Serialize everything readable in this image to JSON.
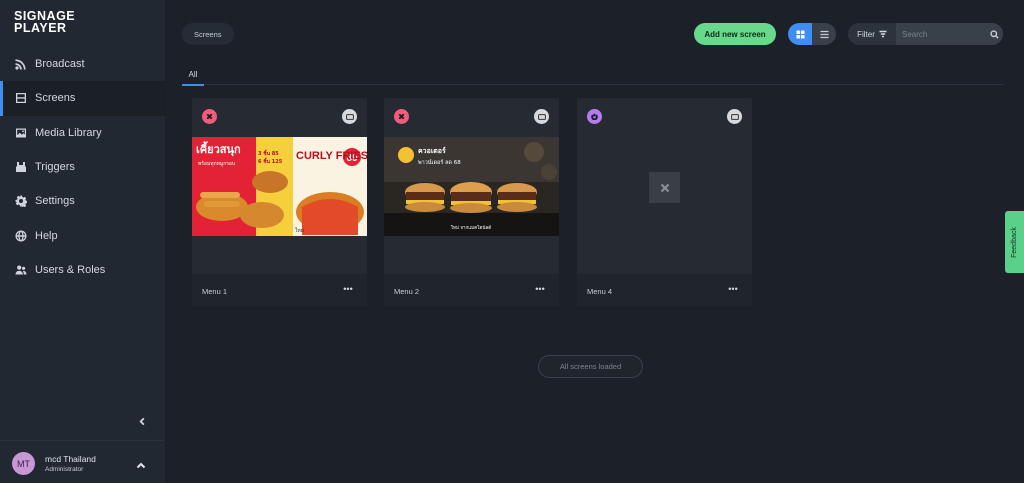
{
  "logo": {
    "line1": "SIGNAGE",
    "line2": "PLAYER"
  },
  "nav": {
    "items": [
      {
        "label": "Broadcast",
        "icon": "rss-icon"
      },
      {
        "label": "Screens",
        "icon": "screens-icon",
        "active": true
      },
      {
        "label": "Media Library",
        "icon": "image-icon"
      },
      {
        "label": "Triggers",
        "icon": "trigger-icon"
      },
      {
        "label": "Settings",
        "icon": "gear-icon"
      },
      {
        "label": "Help",
        "icon": "globe-icon"
      },
      {
        "label": "Users & Roles",
        "icon": "users-icon"
      }
    ]
  },
  "user": {
    "initials": "MT",
    "name": "mcd Thailand",
    "role": "Administrator"
  },
  "header": {
    "breadcrumb": "Screens",
    "add_button": "Add new screen",
    "filter_label": "Filter",
    "search_placeholder": "Search"
  },
  "tabs": [
    {
      "label": "All",
      "active": true
    }
  ],
  "screens": [
    {
      "name": "Menu 1",
      "status": "offline",
      "status_color": "#f25c7a",
      "preview": {
        "headline": "เคี้ยวสนุก",
        "sub": "พร้อมทุกหมูกรอบ",
        "product": "CURLY FRIES",
        "price": "89",
        "price_a": "3 ชิ้น 85",
        "price_b": "6 ชิ้น 125",
        "label_new": "ใหม่"
      }
    },
    {
      "name": "Menu 2",
      "status": "offline",
      "status_color": "#f25c7a",
      "preview": {
        "headline": "ควอเตอร์",
        "sub": "พาวน์เดอร์ ลด 68",
        "caption": "ใหม่ จากแมคโดนัลด์"
      }
    },
    {
      "name": "Menu 4",
      "status": "power",
      "status_color": "#b57cf2",
      "preview": null
    }
  ],
  "footer_status": "All screens loaded",
  "feedback": "Feedback",
  "colors": {
    "accent": "#3f8ef2",
    "add_button": "#67d98a",
    "offline": "#f25c7a",
    "power": "#b57cf2"
  }
}
